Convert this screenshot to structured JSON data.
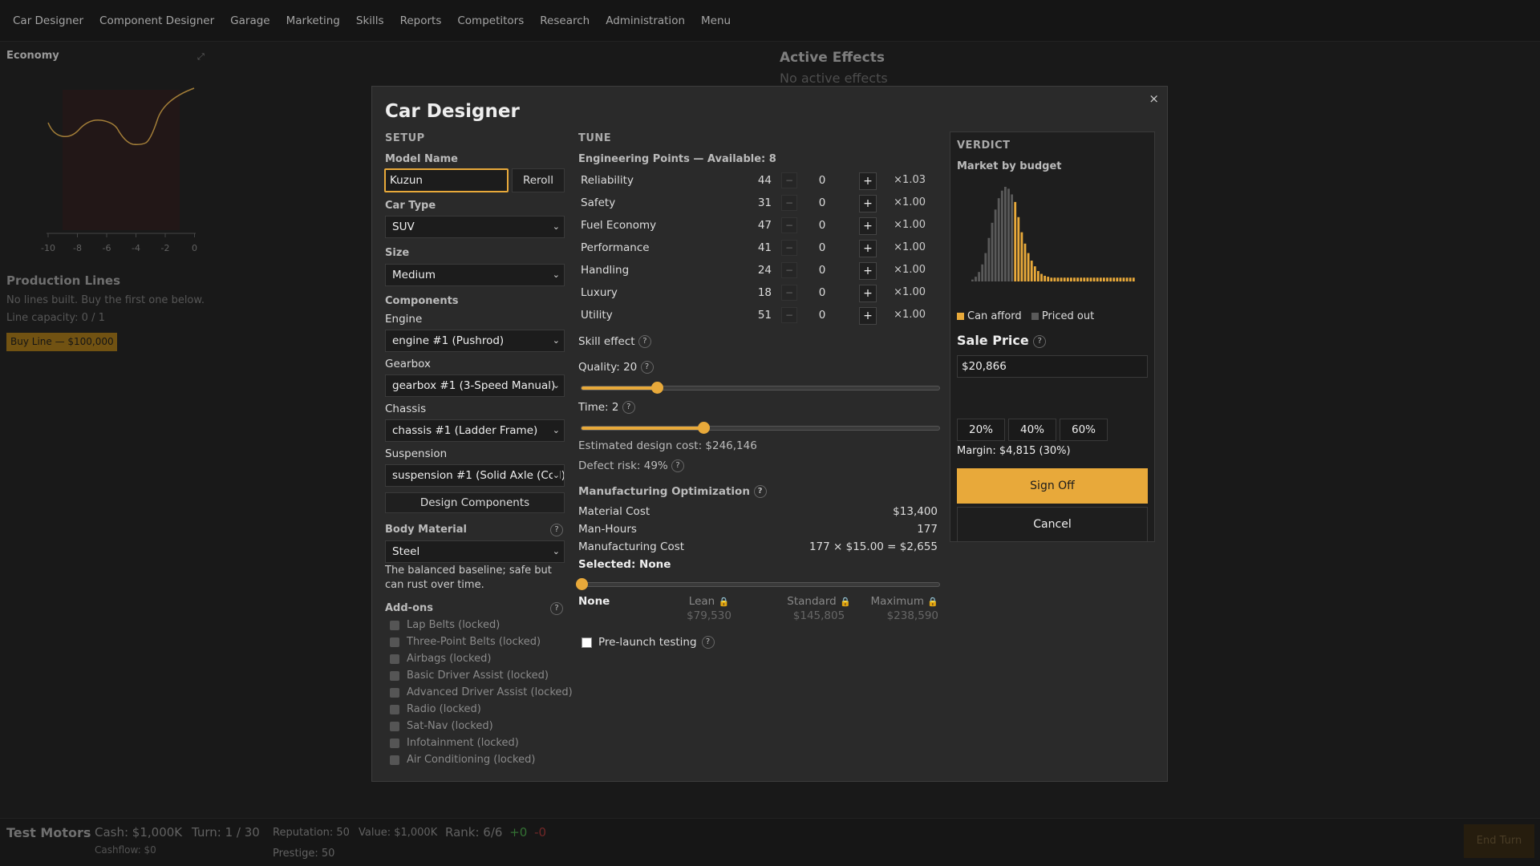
{
  "nav": [
    "Car Designer",
    "Component Designer",
    "Garage",
    "Marketing",
    "Skills",
    "Reports",
    "Competitors",
    "Research",
    "Administration",
    "Menu"
  ],
  "economy": {
    "title": "Economy",
    "x_ticks": [
      "-10",
      "-8",
      "-6",
      "-4",
      "-2",
      "0"
    ]
  },
  "production": {
    "title": "Production Lines",
    "line1": "No lines built. Buy the first one below.",
    "line2": "Line capacity: 0 / 1",
    "buy_label": "Buy Line — $100,000"
  },
  "active_effects": {
    "title": "Active Effects",
    "subtitle": "No active effects"
  },
  "status": {
    "company": "Test Motors",
    "cash": "Cash: $1,000K",
    "cashflow": "Cashflow: $0",
    "turn": "Turn: 1 / 30",
    "reputation": "Reputation: 50",
    "prestige": "Prestige: 50",
    "value": "Value: $1,000K",
    "rank": "Rank: 6/6",
    "rank_up": "+0",
    "rank_down": "-0",
    "end_turn": "End Turn"
  },
  "modal": {
    "title": "Car Designer",
    "close": "×",
    "setup": {
      "heading": "SETUP",
      "model_name_label": "Model Name",
      "model_name": "Kuzun",
      "reroll": "Reroll",
      "car_type_label": "Car Type",
      "car_type": "SUV",
      "size_label": "Size",
      "size": "Medium",
      "components_label": "Components",
      "engine_label": "Engine",
      "engine": "engine #1 (Pushrod)",
      "gearbox_label": "Gearbox",
      "gearbox": "gearbox #1 (3-Speed Manual)",
      "chassis_label": "Chassis",
      "chassis": "chassis #1 (Ladder Frame)",
      "suspension_label": "Suspension",
      "suspension": "suspension #1 (Solid Axle (Coil))",
      "design_components": "Design Components",
      "body_material_label": "Body Material",
      "body_material": "Steel",
      "body_desc": "The balanced baseline; safe but can rust over time.",
      "addons_label": "Add-ons",
      "addons": [
        "Lap Belts (locked)",
        "Three-Point Belts (locked)",
        "Airbags (locked)",
        "Basic Driver Assist (locked)",
        "Advanced Driver Assist (locked)",
        "Radio (locked)",
        "Sat-Nav (locked)",
        "Infotainment (locked)",
        "Air Conditioning (locked)"
      ]
    },
    "tune": {
      "heading": "TUNE",
      "eng_points": "Engineering Points — Available: 8",
      "stats": [
        {
          "name": "Reliability",
          "value": "44",
          "points": "0",
          "mult": "×1.03"
        },
        {
          "name": "Safety",
          "value": "31",
          "points": "0",
          "mult": "×1.00"
        },
        {
          "name": "Fuel Economy",
          "value": "47",
          "points": "0",
          "mult": "×1.00"
        },
        {
          "name": "Performance",
          "value": "41",
          "points": "0",
          "mult": "×1.00"
        },
        {
          "name": "Handling",
          "value": "24",
          "points": "0",
          "mult": "×1.00"
        },
        {
          "name": "Luxury",
          "value": "18",
          "points": "0",
          "mult": "×1.00"
        },
        {
          "name": "Utility",
          "value": "51",
          "points": "0",
          "mult": "×1.00"
        }
      ],
      "minus": "−",
      "plus": "+",
      "skill_effect": "Skill effect",
      "quality_label": "Quality: 20",
      "quality_fraction": 0.21,
      "time_label": "Time: 2",
      "time_fraction": 0.34,
      "est_cost": "Estimated design cost: $246,146",
      "defect_risk": "Defect risk: 49%",
      "mfg_heading": "Manufacturing Optimization",
      "material_cost_label": "Material Cost",
      "material_cost": "$13,400",
      "man_hours_label": "Man-Hours",
      "man_hours": "177",
      "mfg_cost_label": "Manufacturing Cost",
      "mfg_cost": "177 × $15.00 = $2,655",
      "selected": "Selected: None",
      "opt_fraction": 0,
      "options": [
        {
          "name": "None",
          "cost": ""
        },
        {
          "name": "Lean",
          "cost": "$79,530"
        },
        {
          "name": "Standard",
          "cost": "$145,805"
        },
        {
          "name": "Maximum",
          "cost": "$238,590"
        }
      ],
      "prelaunch": "Pre-launch testing"
    },
    "verdict": {
      "heading": "VERDICT",
      "market_label": "Market by budget",
      "legend_afford": "Can afford",
      "legend_priced": "Priced out",
      "afford_color": "#e8a93a",
      "priced_color": "#5a5a5a",
      "sale_price_label": "Sale Price",
      "sale_price": "$20,866",
      "pct_buttons": [
        "20%",
        "40%",
        "60%"
      ],
      "margin": "Margin: $4,815 (30%)",
      "sign_off": "Sign Off",
      "cancel": "Cancel"
    }
  },
  "histogram": [
    2,
    5,
    10,
    18,
    30,
    46,
    62,
    76,
    88,
    96,
    100,
    98,
    92,
    84,
    68,
    52,
    40,
    30,
    22,
    16,
    11,
    8,
    6,
    5,
    4,
    4,
    4,
    4,
    4,
    4,
    4,
    4,
    4,
    4,
    4,
    4,
    4,
    4,
    4,
    4,
    4,
    4,
    4,
    4,
    4,
    4,
    4,
    4,
    4,
    4
  ],
  "histogram_afford_from": 13
}
